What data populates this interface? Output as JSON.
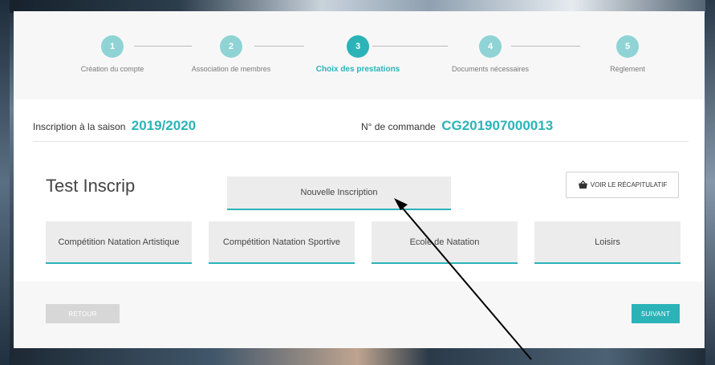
{
  "stepper": {
    "steps": [
      {
        "number": "1",
        "label": "Création du compte"
      },
      {
        "number": "2",
        "label": "Association de membres"
      },
      {
        "number": "3",
        "label": "Choix des prestations"
      },
      {
        "number": "4",
        "label": "Documents nécessaires"
      },
      {
        "number": "5",
        "label": "Règlement"
      }
    ],
    "active_step": 3
  },
  "info": {
    "season_label": "Inscription à la saison",
    "season_value": "2019/2020",
    "order_label": "N° de commande",
    "order_value": "CG201907000013"
  },
  "member": {
    "name": "Test Inscrip",
    "new_inscription_label": "Nouvelle Inscription",
    "recap_label": "VOIR LE RÉCAPITULATIF",
    "recap_icon": "basket-icon"
  },
  "categories": [
    {
      "label": "Compétition Natation Artistique"
    },
    {
      "label": "Compétition Natation Sportive"
    },
    {
      "label": "Ecole de Natation"
    },
    {
      "label": "Loisirs"
    }
  ],
  "footer": {
    "back_label": "RETOUR",
    "next_label": "SUIVANT"
  },
  "colors": {
    "accent": "#2bb3b8",
    "accent_light": "#8fd3d5",
    "button_gray": "#ececec"
  }
}
